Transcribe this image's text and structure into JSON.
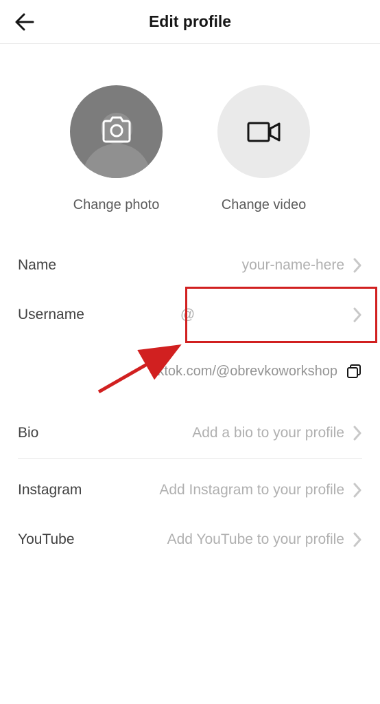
{
  "header": {
    "title": "Edit profile"
  },
  "media": {
    "change_photo_label": "Change photo",
    "change_video_label": "Change video"
  },
  "settings": {
    "name": {
      "label": "Name",
      "value": "your-name-here"
    },
    "username": {
      "label": "Username",
      "value": "@"
    },
    "url": {
      "text": "tiktok.com/@obrevkoworkshop"
    },
    "bio": {
      "label": "Bio",
      "placeholder": "Add a bio to your profile"
    },
    "instagram": {
      "label": "Instagram",
      "placeholder": "Add Instagram to your profile"
    },
    "youtube": {
      "label": "YouTube",
      "placeholder": "Add YouTube to your profile"
    }
  }
}
